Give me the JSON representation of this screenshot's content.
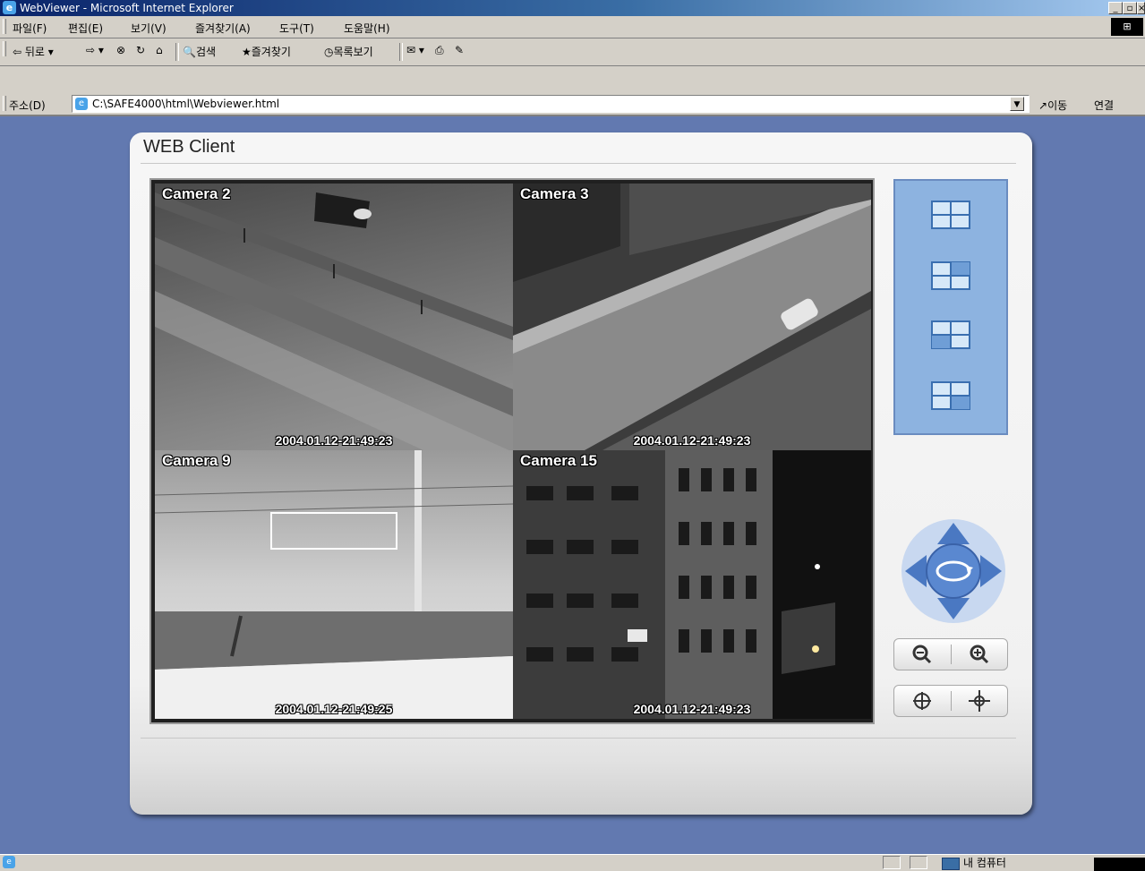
{
  "window": {
    "title": "WebViewer - Microsoft Internet Explorer",
    "minimize": "_",
    "restore": "▫",
    "close": "×"
  },
  "menu": {
    "items": [
      "파일(F)",
      "편집(E)",
      "보기(V)",
      "즐겨찾기(A)",
      "도구(T)",
      "도움말(H)"
    ]
  },
  "toolbar": {
    "back": "⇦ 뒤로",
    "forward": "⇨",
    "stop": "⊗",
    "refresh": "↻",
    "home": "⌂",
    "search": "검색",
    "favorites": "즐겨찾기",
    "history": "목록보기",
    "mail": "✉",
    "print": "⎙",
    "messenger": "✎"
  },
  "address": {
    "label": "주소(D)",
    "url": "C:\\SAFE4000\\html\\Webviewer.html",
    "go": "이동",
    "links": "연결"
  },
  "app": {
    "title": "WEB Client",
    "cameras": [
      {
        "label": "Camera 2",
        "timestamp": "2004.01.12-21:49:23"
      },
      {
        "label": "Camera 3",
        "timestamp": "2004.01.12-21:49:23"
      },
      {
        "label": "Camera 9",
        "timestamp": "2004.01.12-21:49:25"
      },
      {
        "label": "Camera 15",
        "timestamp": "2004.01.12-21:49:23"
      }
    ],
    "colors": {
      "background": "#6279b0",
      "layout_panel": "#8db3e0",
      "ptz_blue": "#4a78c2"
    }
  },
  "status": {
    "zone": "내 컴퓨터"
  }
}
